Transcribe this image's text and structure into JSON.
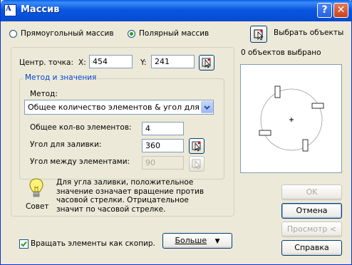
{
  "window": {
    "title": "Массив"
  },
  "array_type": {
    "rectangular_label": "Прямоугольный массив",
    "polar_label": "Полярный массив",
    "selected": "polar"
  },
  "select_objects": {
    "label": "Выбрать объекты",
    "count_text": "0 объектов выбрано"
  },
  "center": {
    "label": "Центр. точка:",
    "x_label": "X:",
    "x_value": "454",
    "y_label": "Y:",
    "y_value": "241"
  },
  "method_group": {
    "title": "Метод и значения",
    "method_label": "Метод:",
    "method_value": "Общее количество элементов & угол для заливки",
    "total_items_label": "Общее кол-во элементов:",
    "total_items_value": "4",
    "fill_angle_label": "Угол для заливки:",
    "fill_angle_value": "360",
    "angle_between_label": "Угол между элементами:",
    "angle_between_value": "90"
  },
  "tip": {
    "title": "Совет",
    "text": "Для угла заливки, положительное значение означает вращение против часовой стрелки.  Отрицательное значит по часовой стрелке."
  },
  "rotate_items": {
    "label": "Вращать элементы как скопир.",
    "checked": true
  },
  "buttons": {
    "more": "Больше",
    "ok": "OK",
    "cancel": "Отмена",
    "preview": "Просмотр <",
    "help": "Справка"
  }
}
